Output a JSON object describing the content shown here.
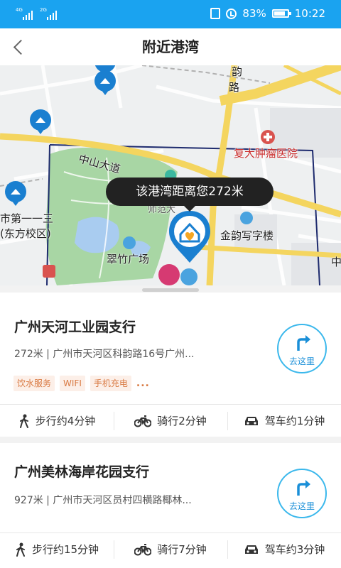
{
  "status_bar": {
    "signal_1": "4G",
    "signal_2": "2G",
    "battery": "83%",
    "time": "10:22"
  },
  "header": {
    "title": "附近港湾",
    "back_icon": "chevron-left-icon"
  },
  "map": {
    "tooltip": "该港湾距离您272米",
    "labels": {
      "road_zhongshan": "中山大道",
      "road_yun": "韵",
      "road_lu": "路",
      "hospital": "复大肿瘤医院",
      "building": "金韵写字楼",
      "square": "翠竹广场",
      "school_1": "市第一一三",
      "school_2": "(东方校区)",
      "normal": "师范大",
      "zhong": "中"
    },
    "colors": {
      "park": "#a8d6a4",
      "water": "#a9ccf0",
      "road_major": "#f4d55f",
      "road_boundary": "#1e2b6e",
      "pin": "#1a7fd0",
      "pin_heart": "#f5a623"
    }
  },
  "branches": [
    {
      "name": "广州天河工业园支行",
      "info": "272米 | 广州市天河区科韵路16号广州...",
      "tags": [
        "饮水服务",
        "WIFI",
        "手机充电"
      ],
      "tags_more": "...",
      "go_label": "去这里",
      "walk": "步行约4分钟",
      "bike": "骑行2分钟",
      "drive": "驾车约1分钟"
    },
    {
      "name": "广州美林海岸花园支行",
      "info": "927米 | 广州市天河区员村四横路椰林...",
      "go_label": "去这里",
      "walk": "步行约15分钟",
      "bike": "骑行7分钟",
      "drive": "驾车约3分钟"
    }
  ],
  "colors": {
    "status_bar": "#1aa3f0",
    "accent": "#3bb8ec",
    "tag_bg": "#fcefe8",
    "tag_text": "#d97a43"
  }
}
